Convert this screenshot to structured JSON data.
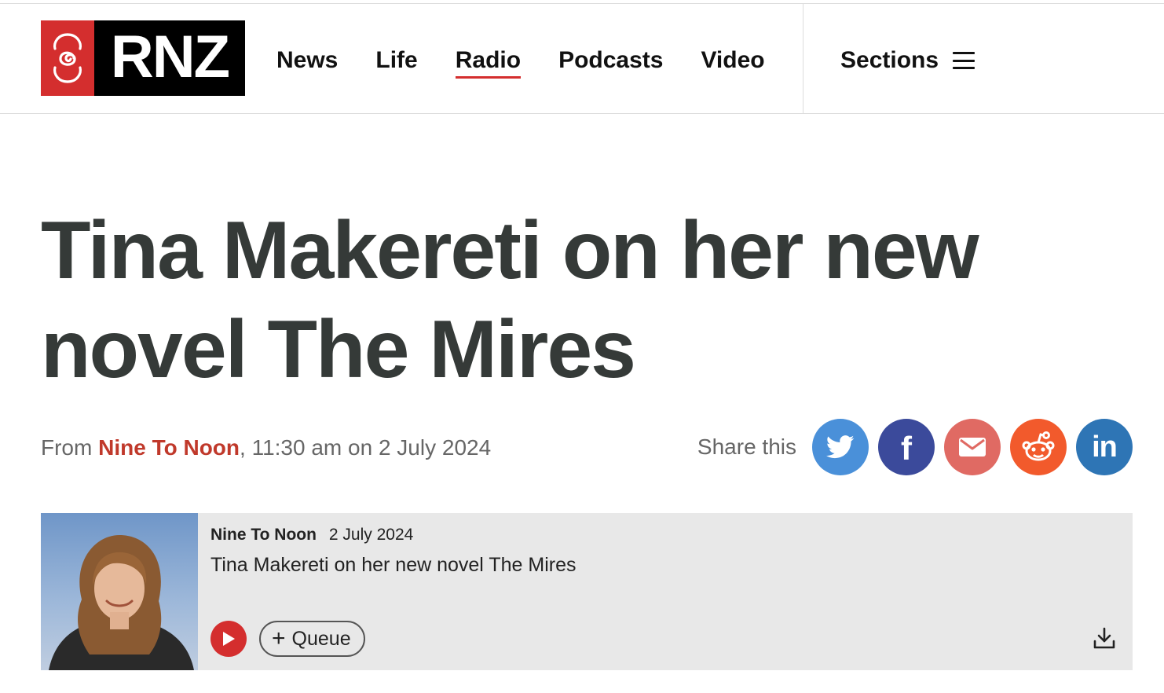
{
  "brand": {
    "logo_text": "RNZ",
    "accent": "#d42e2e"
  },
  "nav": {
    "items": [
      {
        "label": "News",
        "active": false
      },
      {
        "label": "Life",
        "active": false
      },
      {
        "label": "Radio",
        "active": true
      },
      {
        "label": "Podcasts",
        "active": false
      },
      {
        "label": "Video",
        "active": false
      }
    ],
    "sections_label": "Sections"
  },
  "article": {
    "title": "Tina Makereti on her new novel The Mires",
    "meta": {
      "from_label": "From",
      "programme": "Nine To Noon",
      "separator": ",",
      "datetime": "11:30 am on 2 July 2024"
    }
  },
  "share": {
    "label": "Share this",
    "buttons": [
      {
        "name": "twitter",
        "icon": "twitter-bird-icon",
        "color": "#4a90d9"
      },
      {
        "name": "facebook",
        "icon": "facebook-f-icon",
        "glyph": "f",
        "color": "#3b4a9b"
      },
      {
        "name": "email",
        "icon": "envelope-icon",
        "color": "#e06a63"
      },
      {
        "name": "reddit",
        "icon": "reddit-alien-icon",
        "color": "#f25a2c"
      },
      {
        "name": "linkedin",
        "icon": "linkedin-in-icon",
        "glyph": "in",
        "color": "#2e75b5"
      }
    ]
  },
  "player": {
    "programme": "Nine To Noon",
    "date": "2 July 2024",
    "title": "Tina Makereti on her new novel The Mires",
    "queue_label": "Queue"
  }
}
